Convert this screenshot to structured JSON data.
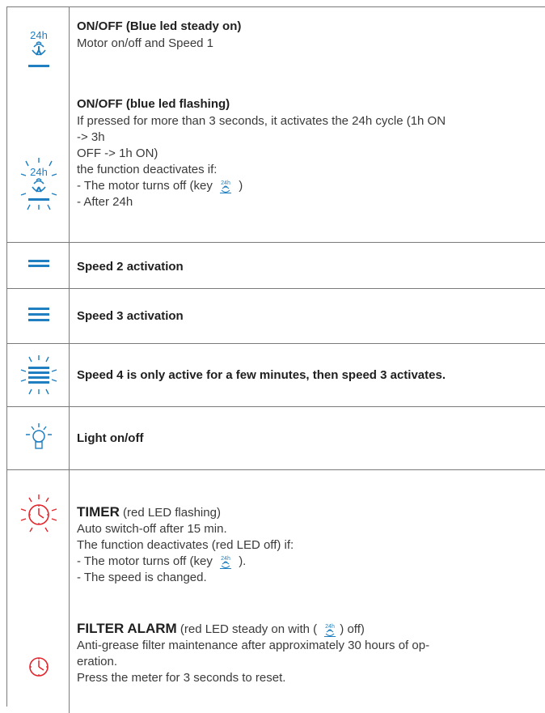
{
  "icons": {
    "fan_24h": "fan-24h-icon",
    "fan_24h_flashing": "fan-24h-flashing-icon",
    "speed2": "speed-2-icon",
    "speed3": "speed-3-icon",
    "speed4": "speed-4-icon",
    "light": "light-bulb-icon",
    "timer": "timer-clock-flashing-icon",
    "filter": "filter-alarm-clock-icon",
    "label_24h": "24h",
    "blue": "#1f7fc0",
    "red": "#e3242b"
  },
  "rows": {
    "onoff": {
      "steady_title": "ON/OFF (Blue led steady on)",
      "steady_desc": "Motor on/off and Speed 1",
      "flash_title": "ON/OFF (blue led flashing)",
      "flash_line1": "If pressed for more than 3 seconds, it activates the 24h cycle (1h ON",
      "flash_line2": "-> 3h",
      "flash_line3": "OFF -> 1h ON)",
      "flash_line4": "the function deactivates if:",
      "flash_line5_pre": "- The motor turns off (key",
      "flash_line5_post": ")",
      "flash_line6": "- After 24h"
    },
    "speed2": "Speed 2 activation",
    "speed3": "Speed 3 activation",
    "speed4": "Speed 4 is only active for a few minutes, then speed 3 activates.",
    "light": "Light on/off",
    "timer": {
      "title": "TIMER",
      "title_note": " (red LED flashing)",
      "line1": "Auto switch-off after 15 min.",
      "line2": "The function deactivates (red LED off) if:",
      "line3_pre": "- The motor turns off (key",
      "line3_post": ").",
      "line4": "- The speed is changed.",
      "filter_title": "FILTER ALARM",
      "filter_note_pre": " (red LED steady on with (",
      "filter_note_post": ") off)",
      "filter_line1": "Anti-grease filter maintenance after approximately 30 hours of op-",
      "filter_line2": "eration.",
      "filter_line3": "Press the meter for 3 seconds to reset."
    }
  }
}
